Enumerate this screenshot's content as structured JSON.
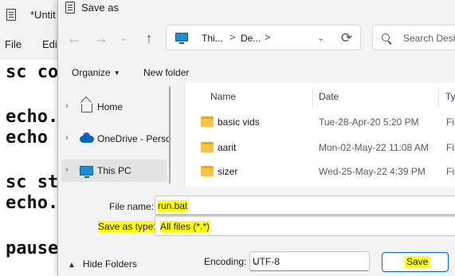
{
  "notepad": {
    "title": "*Untit",
    "menu": [
      "File",
      "Edi"
    ],
    "lines": [
      "sc co",
      "echo.",
      "echo ",
      "sc st",
      "echo.",
      "pause"
    ]
  },
  "dialog": {
    "title": "Save as",
    "address": {
      "crumb1": "Thi...",
      "sep": ">",
      "crumb2": "De..."
    },
    "search_placeholder": "Search Deskt",
    "commands": {
      "organize": "Organize",
      "new_folder": "New folder"
    },
    "nav": [
      {
        "label": "Home",
        "icon": "home-icon"
      },
      {
        "label": "OneDrive - Perso",
        "icon": "cloud-icon"
      },
      {
        "label": "This PC",
        "icon": "computer-icon",
        "selected": true
      }
    ],
    "columns": [
      "Name",
      "Date",
      "Typ"
    ],
    "files": [
      {
        "name": "basic vids",
        "date": "Tue-28-Apr-20 5:20 PM",
        "type": "File"
      },
      {
        "name": "aarit",
        "date": "Mon-02-May-22 11:08 AM",
        "type": "File"
      },
      {
        "name": "sizer",
        "date": "Wed-25-May-22 4:39 PM",
        "type": "File"
      }
    ],
    "file_name_label": "File name:",
    "file_name_value": "run.bat",
    "save_type_label": "Save as type:",
    "save_type_value": "All files  (*.*)",
    "hide_folders": "Hide Folders",
    "encoding_label": "Encoding:",
    "encoding_value": "UTF-8",
    "save_button": "Save",
    "highlight_color": "#ffff00",
    "accent_color": "#0067c0"
  }
}
